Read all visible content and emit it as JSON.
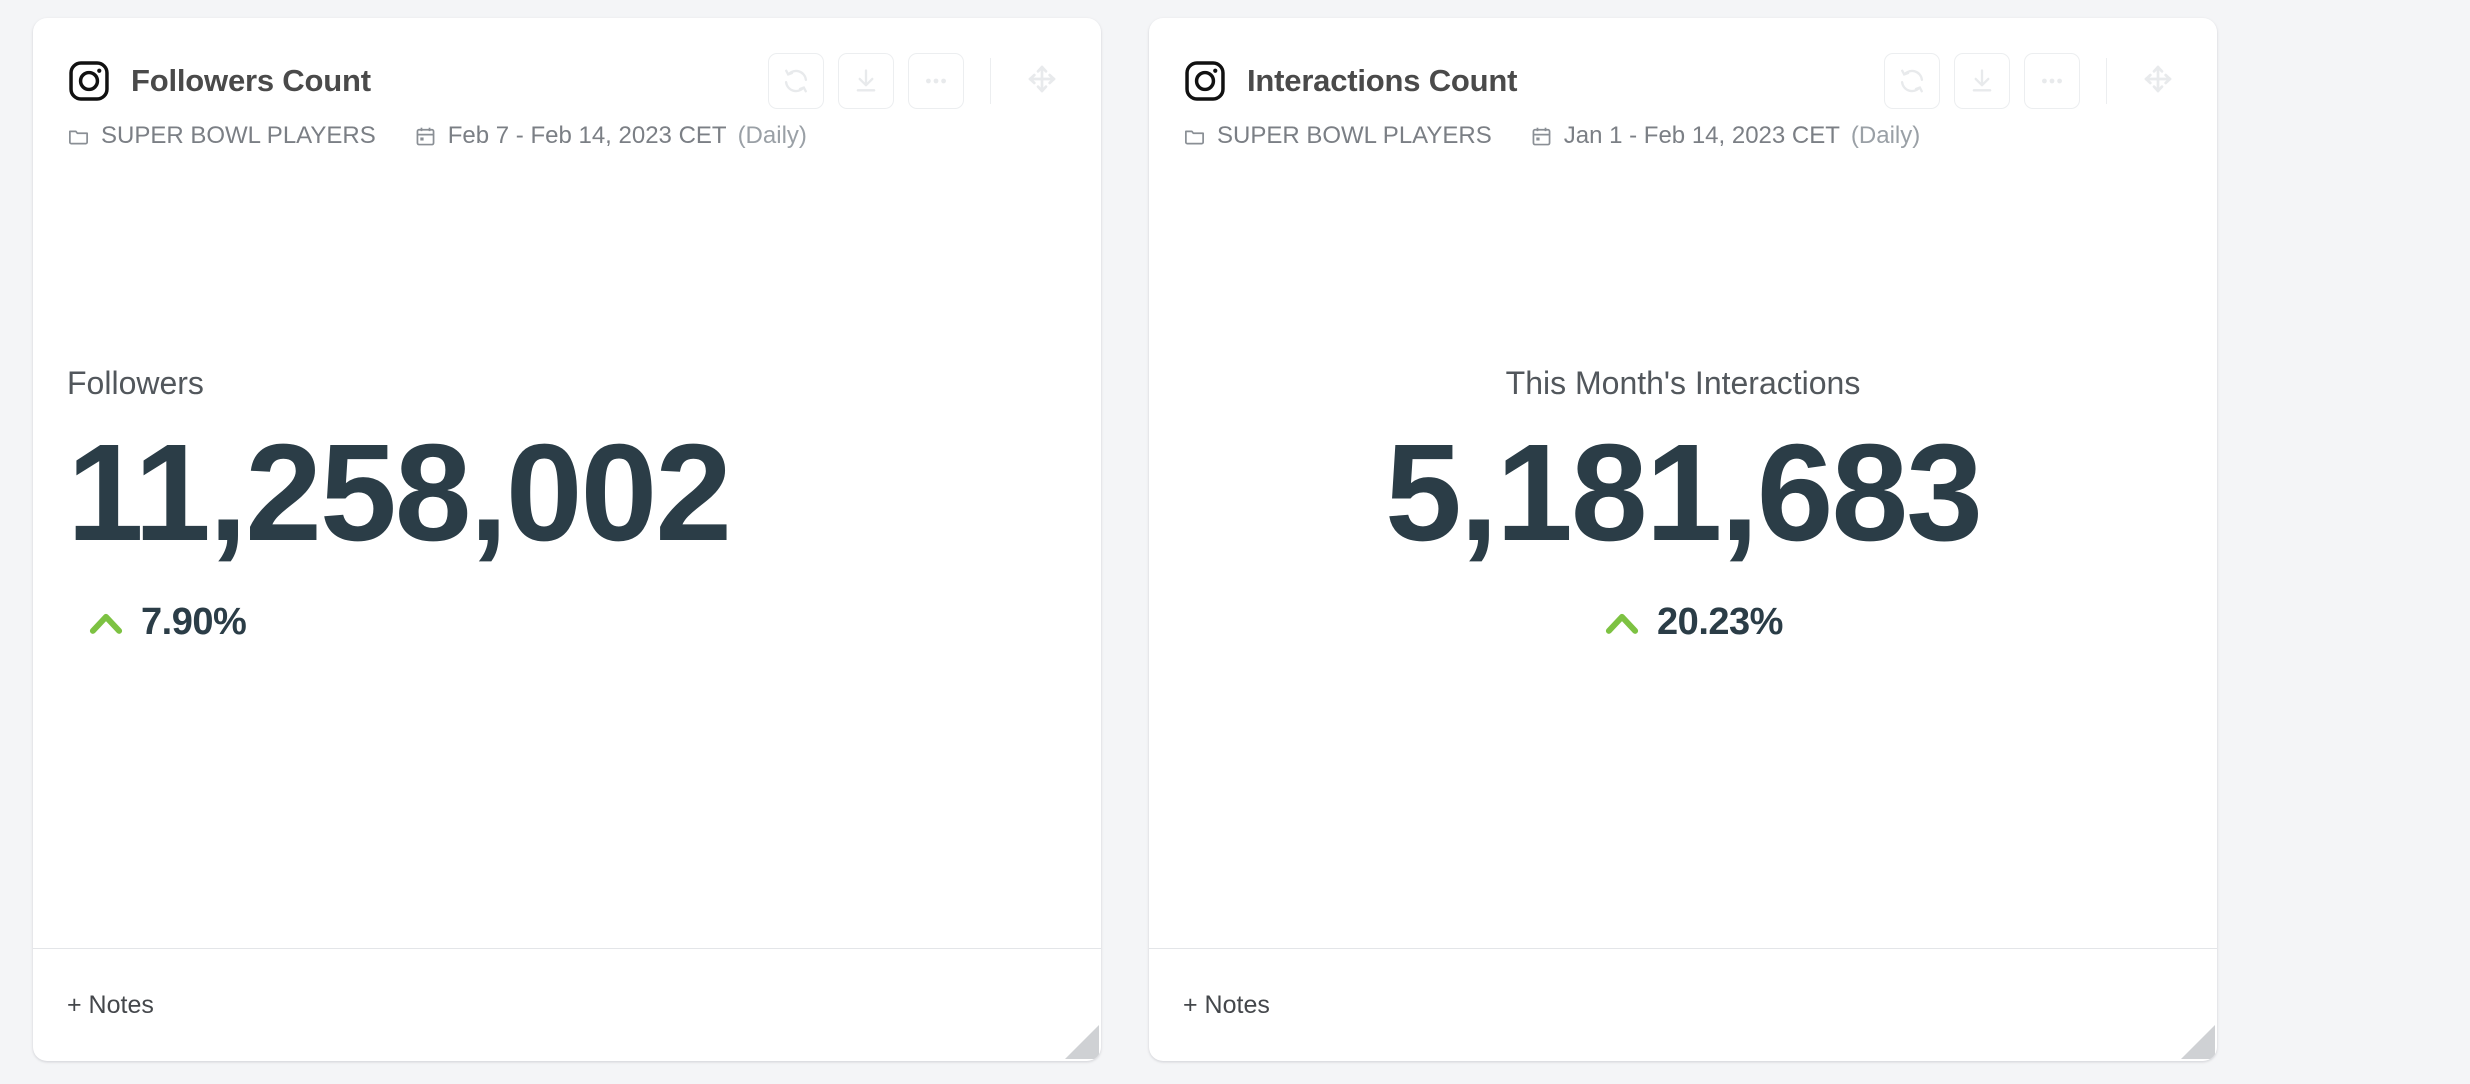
{
  "theme": {
    "page_background": "#f4f5f7",
    "card_background": "#ffffff",
    "metric_value_color": "#2b3d47",
    "positive_delta_color": "#7dc242",
    "muted_text_color": "#7b7f85",
    "resize_handle_color": "#cfd1d4"
  },
  "widgets": [
    {
      "platform_icon": "instagram-icon",
      "title": "Followers Count",
      "actions": {
        "refresh_icon": "refresh-icon",
        "download_icon": "download-icon",
        "more_icon": "more-options-icon",
        "move_icon": "move-handle-icon"
      },
      "meta": {
        "folder_icon": "folder-icon",
        "group": "SUPER BOWL PLAYERS",
        "calendar_icon": "calendar-icon",
        "date_range": "Feb 7 - Feb 14, 2023 CET",
        "granularity": "(Daily)"
      },
      "metric": {
        "label": "Followers",
        "value": "11,258,002",
        "delta": "7.90%",
        "delta_direction": "up",
        "delta_icon": "chevron-up-icon"
      },
      "footer": {
        "notes_label": "+ Notes"
      },
      "align": "left"
    },
    {
      "platform_icon": "instagram-icon",
      "title": "Interactions Count",
      "actions": {
        "refresh_icon": "refresh-icon",
        "download_icon": "download-icon",
        "more_icon": "more-options-icon",
        "move_icon": "move-handle-icon"
      },
      "meta": {
        "folder_icon": "folder-icon",
        "group": "SUPER BOWL PLAYERS",
        "calendar_icon": "calendar-icon",
        "date_range": "Jan 1 - Feb 14, 2023 CET",
        "granularity": "(Daily)"
      },
      "metric": {
        "label": "This Month's Interactions",
        "value": "5,181,683",
        "delta": "20.23%",
        "delta_direction": "up",
        "delta_icon": "chevron-up-icon"
      },
      "footer": {
        "notes_label": "+ Notes"
      },
      "align": "center"
    }
  ]
}
